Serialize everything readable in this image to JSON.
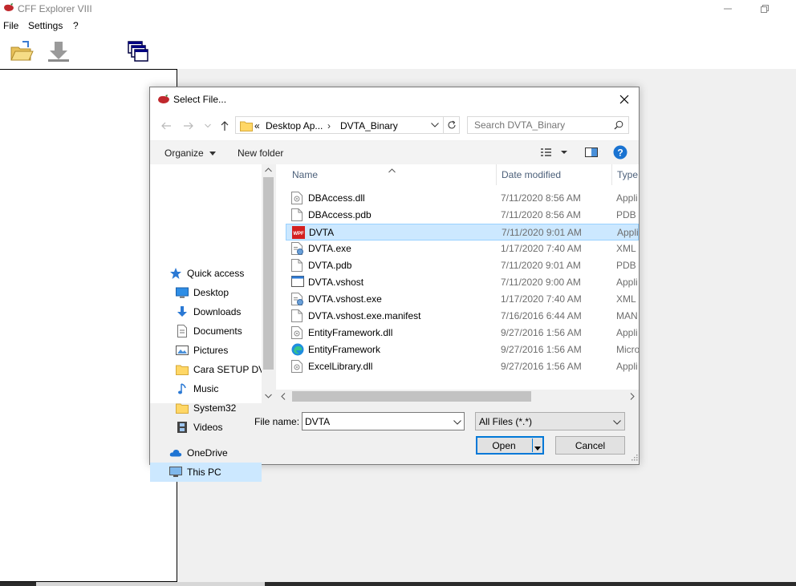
{
  "app": {
    "title": "CFF Explorer VIII",
    "menu": [
      "File",
      "Settings",
      "?"
    ]
  },
  "dialog": {
    "title": "Select File...",
    "address": {
      "overflow": "«",
      "crumbs": [
        "Desktop Ap...",
        "DVTA_Binary"
      ]
    },
    "search_placeholder": "Search DVTA_Binary",
    "commands": {
      "organize": "Organize",
      "new_folder": "New folder"
    },
    "nav": {
      "quick_access": "Quick access",
      "items": [
        "Desktop",
        "Downloads",
        "Documents",
        "Pictures",
        "Cara SETUP DVTA",
        "Music",
        "System32",
        "Videos"
      ],
      "onedrive": "OneDrive",
      "this_pc": "This PC"
    },
    "columns": {
      "name": "Name",
      "date": "Date modified",
      "type": "Type"
    },
    "files": [
      {
        "name": "DBAccess.dll",
        "date": "7/11/2020 8:56 AM",
        "type": "Appli",
        "icon": "dll-icon"
      },
      {
        "name": "DBAccess.pdb",
        "date": "7/11/2020 8:56 AM",
        "type": "PDB F",
        "icon": "blank-file-icon"
      },
      {
        "name": "DVTA",
        "date": "7/11/2020 9:01 AM",
        "type": "Appli",
        "icon": "dvta-app-icon"
      },
      {
        "name": "DVTA.exe",
        "date": "1/17/2020 7:40 AM",
        "type": "XML",
        "icon": "config-file-icon"
      },
      {
        "name": "DVTA.pdb",
        "date": "7/11/2020 9:01 AM",
        "type": "PDB F",
        "icon": "blank-file-icon"
      },
      {
        "name": "DVTA.vshost",
        "date": "7/11/2020 9:00 AM",
        "type": "Appli",
        "icon": "window-app-icon"
      },
      {
        "name": "DVTA.vshost.exe",
        "date": "1/17/2020 7:40 AM",
        "type": "XML",
        "icon": "config-file-icon"
      },
      {
        "name": "DVTA.vshost.exe.manifest",
        "date": "7/16/2016 6:44 AM",
        "type": "MAN",
        "icon": "blank-file-icon"
      },
      {
        "name": "EntityFramework.dll",
        "date": "9/27/2016 1:56 AM",
        "type": "Appli",
        "icon": "dll-icon"
      },
      {
        "name": "EntityFramework",
        "date": "9/27/2016 1:56 AM",
        "type": "Micro",
        "icon": "edge-icon"
      },
      {
        "name": "ExcelLibrary.dll",
        "date": "9/27/2016 1:56 AM",
        "type": "Appli",
        "icon": "dll-icon"
      }
    ],
    "selected_file_index": 2,
    "file_name_label": "File name:",
    "file_name_value": "DVTA",
    "filter_value": "All Files (*.*)",
    "open_label": "Open",
    "cancel_label": "Cancel"
  }
}
